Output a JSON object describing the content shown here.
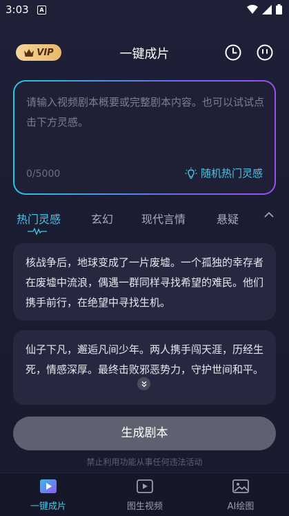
{
  "status_bar": {
    "time": "3:03",
    "notification_letter": "A"
  },
  "header": {
    "vip_label": "VIP",
    "title": "一键成片"
  },
  "input": {
    "placeholder": "请输入视频剧本概要或完整剧本内容。也可以试试点击下方灵感。",
    "char_count": "0/5000",
    "random_label": "随机热门灵感"
  },
  "tabs": [
    {
      "label": "热门灵感",
      "active": true
    },
    {
      "label": "玄幻"
    },
    {
      "label": "现代言情"
    },
    {
      "label": "悬疑"
    }
  ],
  "inspirations": [
    {
      "text": "核战争后，地球变成了一片废墟。一个孤独的幸存者在废墟中流浪，偶遇一群同样寻找希望的难民。他们携手前行，在绝望中寻找生机。"
    },
    {
      "text": "仙子下凡，邂逅凡间少年。两人携手闯天涯，历经生死，情感深厚。最终击败邪恶势力，守护世间和平。"
    }
  ],
  "generate_button": "生成剧本",
  "notice": "禁止利用功能从事任何违法活动",
  "bottom_nav": [
    {
      "label": "一键成片",
      "active": true
    },
    {
      "label": "图生视频"
    },
    {
      "label": "AI绘图"
    }
  ],
  "colors": {
    "accent": "#4cc6e6",
    "vip_gold": "#f0c47e",
    "button_gray": "#5f6070"
  }
}
